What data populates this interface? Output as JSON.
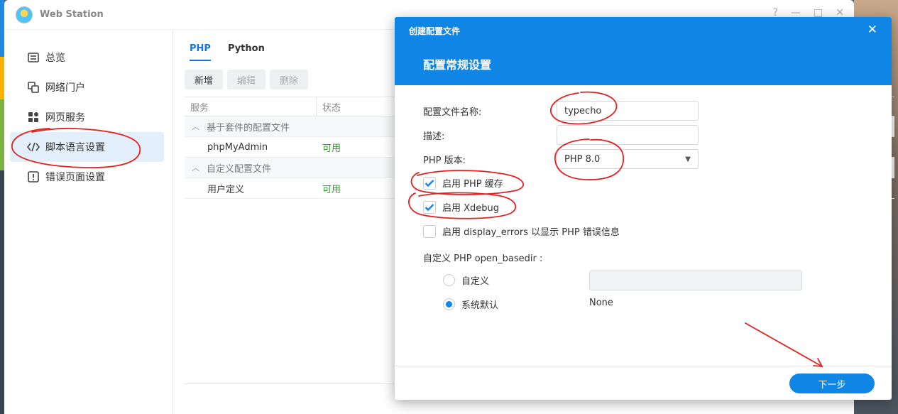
{
  "colors": {
    "accent": "#0f86e6",
    "status_ok": "#2e9b2e",
    "annotation": "#e52222"
  },
  "window": {
    "title": "Web Station",
    "controls": {
      "help": "?",
      "minimize": "—",
      "maximize": "□",
      "close": "✕"
    }
  },
  "sidebar": {
    "items": [
      {
        "label": "总览",
        "icon": "overview-icon"
      },
      {
        "label": "网络门户",
        "icon": "portal-icon"
      },
      {
        "label": "网页服务",
        "icon": "service-icon"
      },
      {
        "label": "脚本语言设置",
        "icon": "code-icon"
      },
      {
        "label": "错误页面设置",
        "icon": "error-icon"
      }
    ],
    "active_index": 3
  },
  "main": {
    "tabs": [
      {
        "label": "PHP"
      },
      {
        "label": "Python"
      }
    ],
    "toolbar": {
      "add": "新增",
      "edit": "编辑",
      "delete": "删除"
    },
    "table": {
      "columns": [
        "服务",
        "状态"
      ],
      "groups": [
        {
          "label": "基于套件的配置文件",
          "rows": [
            {
              "name": "phpMyAdmin",
              "status": "可用"
            }
          ]
        },
        {
          "label": "自定义配置文件",
          "rows": [
            {
              "name": "用户定义",
              "status": "可用"
            }
          ]
        }
      ]
    }
  },
  "modal": {
    "window_title": "创建配置文件",
    "close": "✕",
    "heading": "配置常规设置",
    "fields": {
      "profile_name_label": "配置文件名称:",
      "profile_name_value": "typecho",
      "description_label": "描述:",
      "description_value": "",
      "php_version_label": "PHP 版本:",
      "php_version_value": "PHP 8.0"
    },
    "checkboxes": {
      "php_cache": {
        "label": "启用 PHP 缓存",
        "checked": true
      },
      "xdebug": {
        "label": "启用 Xdebug",
        "checked": true
      },
      "display_errors": {
        "label": "启用 display_errors 以显示 PHP 错误信息",
        "checked": false
      }
    },
    "open_basedir": {
      "label": "自定义 PHP open_basedir :",
      "custom_label": "自定义",
      "custom_value": "",
      "default_label": "系统默认",
      "default_value": "None",
      "selected": "default"
    },
    "next_button": "下一步"
  }
}
